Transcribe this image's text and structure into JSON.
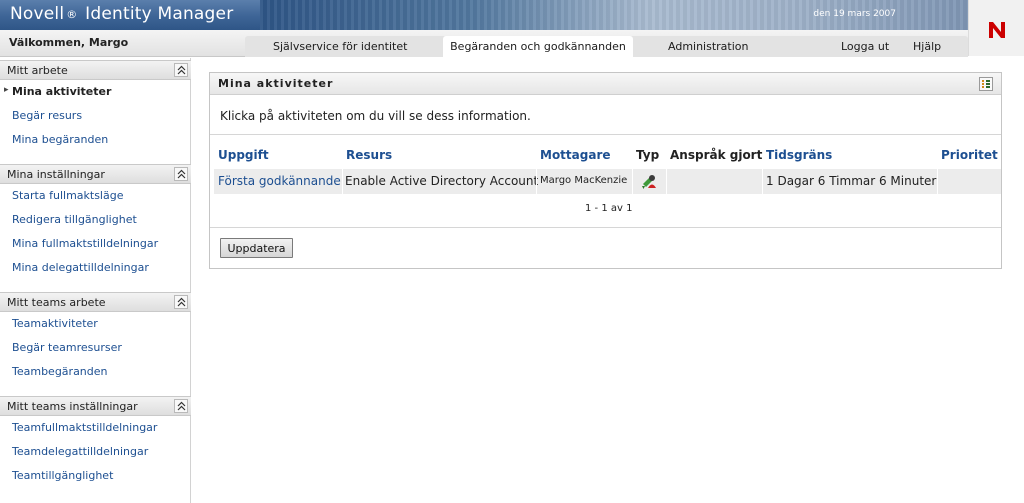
{
  "header": {
    "brand": "Novell",
    "brand_reg": "®",
    "product": "Identity Manager",
    "date": "den 19 mars 2007",
    "logo_letter": "N",
    "logo_color": "#cc0000"
  },
  "nav": {
    "welcome": "Välkommen, Margo",
    "tabs": [
      {
        "label": "Självservice för identitet",
        "active": false
      },
      {
        "label": "Begäranden och godkännanden",
        "active": true
      },
      {
        "label": "Administration",
        "active": false
      }
    ],
    "logout": "Logga ut",
    "help": "Hjälp"
  },
  "sidebar": {
    "sections": [
      {
        "title": "Mitt arbete",
        "items": [
          "Mina aktiviteter",
          "Begär resurs",
          "Mina begäranden"
        ],
        "current": "Mina aktiviteter"
      },
      {
        "title": "Mina inställningar",
        "items": [
          "Starta fullmaktsläge",
          "Redigera tillgänglighet",
          "Mina fullmaktstilldelningar",
          "Mina delegattilldelningar"
        ]
      },
      {
        "title": "Mitt teams arbete",
        "items": [
          "Teamaktiviteter",
          "Begär teamresurser",
          "Teambegäranden"
        ]
      },
      {
        "title": "Mitt teams inställningar",
        "items": [
          "Teamfullmaktstilldelningar",
          "Teamdelegattilldelningar",
          "Teamtillgänglighet"
        ]
      }
    ]
  },
  "panel": {
    "title": "Mina aktiviteter",
    "intro": "Klicka på aktiviteten om du vill se dess information.",
    "columns": {
      "task": "Uppgift",
      "resource": "Resurs",
      "recipient": "Mottagare",
      "type": "Typ",
      "claimed": "Anspråk gjort",
      "deadline": "Tidsgräns",
      "priority": "Prioritet"
    },
    "rows": [
      {
        "task": "Första godkännande",
        "resource": "Enable Active Directory Account",
        "recipient": "Margo MacKenzie",
        "type_icon": "user-assignment-icon",
        "claimed": "",
        "deadline": "1 Dagar 6 Timmar 6 Minuter",
        "priority": ""
      }
    ],
    "pager": "1 - 1 av 1",
    "refresh_label": "Uppdatera"
  },
  "colors": {
    "link": "#1d4f91",
    "header_blue": "#3d6496"
  }
}
